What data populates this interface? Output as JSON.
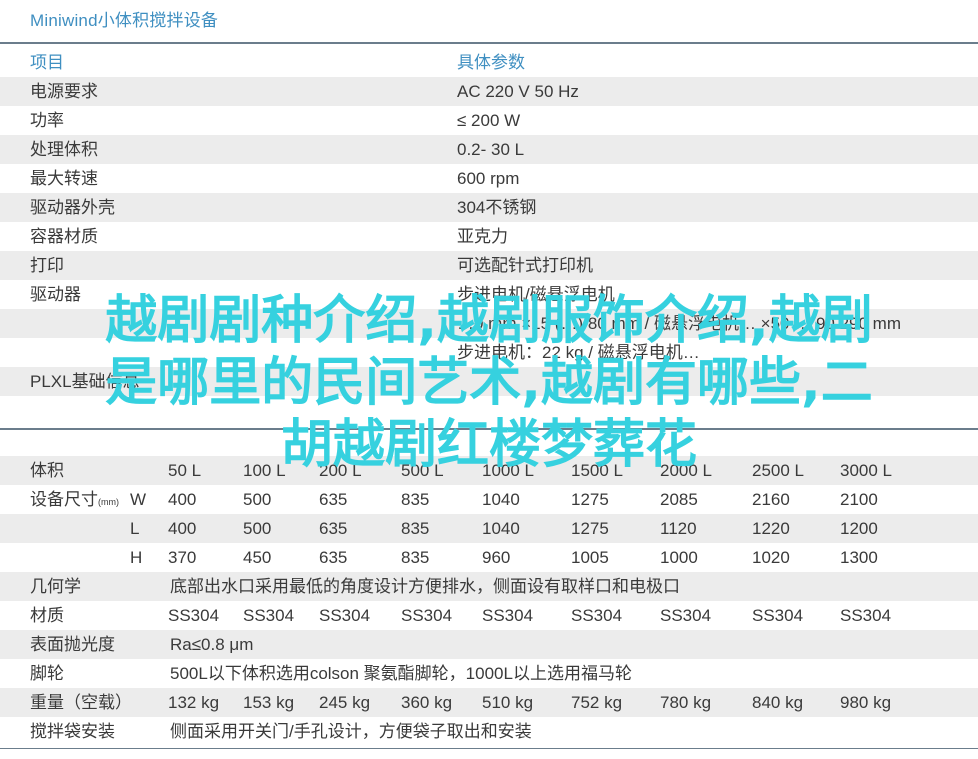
{
  "document": {
    "title": "Miniwind小体积搅拌设备"
  },
  "spec_table": {
    "header": {
      "label": "项目",
      "value": "具体参数"
    },
    "rows": [
      {
        "label": "电源要求",
        "value": "AC 220  V 50 Hz"
      },
      {
        "label": "功率",
        "value": "≤ 200 W"
      },
      {
        "label": "处理体积",
        "value": "0.2-  30 L"
      },
      {
        "label": "最大转速",
        "value": "600  rpm"
      },
      {
        "label": "驱动器外壳",
        "value": "304不锈钢"
      },
      {
        "label": "容器材质",
        "value": "亚克力"
      },
      {
        "label": "打印",
        "value": "可选配针式打印机"
      },
      {
        "label": "驱动器",
        "value": "步进电机/磁悬浮电机"
      },
      {
        "label": "",
        "value": "…0 mm ×15  (…) 80 mm / 磁悬浮电机…  ×50 … 90  290 mm"
      },
      {
        "label": "",
        "value": "步进电机：22 kg / 磁悬浮电机…"
      },
      {
        "label": "PLXL基础信息",
        "value": ""
      }
    ]
  },
  "volume_table": {
    "columns": [
      "50 L",
      "100 L",
      "200 L",
      "500 L",
      "1000 L",
      "1500 L",
      "2000 L",
      "2500 L",
      "3000 L"
    ],
    "rows": [
      {
        "label": "体积",
        "unit": "",
        "sub": "",
        "values": [
          "50 L",
          "100 L",
          "200 L",
          "500 L",
          "1000 L",
          "1500 L",
          "2000 L",
          "2500 L",
          "3000 L"
        ]
      },
      {
        "label": "设备尺寸",
        "unit": "(mm)",
        "sub": "W",
        "values": [
          "400",
          "500",
          "635",
          "835",
          "1040",
          "1275",
          "2085",
          "2160",
          "2100"
        ]
      },
      {
        "label": "",
        "unit": "",
        "sub": "L",
        "values": [
          "400",
          "500",
          "635",
          "835",
          "1040",
          "1275",
          "1120",
          "1220",
          "1200"
        ]
      },
      {
        "label": "",
        "unit": "",
        "sub": "H",
        "values": [
          "370",
          "450",
          "635",
          "835",
          "960",
          "1005",
          "1000",
          "1020",
          "1300"
        ]
      },
      {
        "label": "几何学",
        "unit": "",
        "sub": "",
        "span": "底部出水口采用最低的角度设计方便排水，侧面设有取样口和电极口"
      },
      {
        "label": "材质",
        "unit": "",
        "sub": "",
        "values": [
          "SS304",
          "SS304",
          "SS304",
          "SS304",
          "SS304",
          "SS304",
          "SS304",
          "SS304",
          "SS304"
        ]
      },
      {
        "label": "表面抛光度",
        "unit": "",
        "sub": "",
        "span": "Ra≤0.8 μm"
      },
      {
        "label": "脚轮",
        "unit": "",
        "sub": "",
        "span": "500L以下体积选用colson 聚氨酯脚轮，1000L以上选用福马轮"
      },
      {
        "label": "重量（空载）",
        "unit": "",
        "sub": "",
        "values": [
          "132 kg",
          "153 kg",
          "245 kg",
          "360 kg",
          "510 kg",
          "752 kg",
          "780 kg",
          "840 kg",
          "980 kg"
        ]
      },
      {
        "label": "搅拌袋安装",
        "unit": "",
        "sub": "",
        "span": "侧面采用开关门/手孔设计，方便袋子取出和安装"
      }
    ]
  },
  "overlay": {
    "lines": [
      "越剧剧种介绍,越剧服饰介绍,越剧",
      "是哪里的民间艺术,越剧有哪些,二",
      "胡越剧红楼梦葬花"
    ]
  }
}
